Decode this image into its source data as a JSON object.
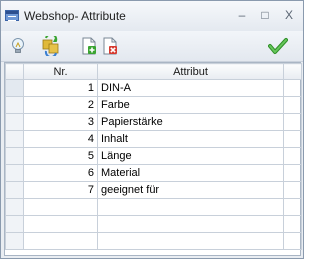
{
  "window": {
    "title": "Webshop- Attribute"
  },
  "title_buttons": {
    "minimize": "–",
    "maximize": "□",
    "close": "X"
  },
  "toolbar": {
    "icons": [
      "lightbulb-icon",
      "refresh-puzzle-icon",
      "add-document-icon",
      "delete-document-icon",
      "confirm-checkmark-icon"
    ]
  },
  "table": {
    "columns": [
      "Nr.",
      "Attribut"
    ],
    "rows": [
      {
        "nr": "1",
        "attribut": "DIN-A"
      },
      {
        "nr": "2",
        "attribut": "Farbe"
      },
      {
        "nr": "3",
        "attribut": "Papierstärke"
      },
      {
        "nr": "4",
        "attribut": "Inhalt"
      },
      {
        "nr": "5",
        "attribut": "Länge"
      },
      {
        "nr": "6",
        "attribut": "Material"
      },
      {
        "nr": "7",
        "attribut": "geeignet für"
      }
    ]
  },
  "colors": {
    "accent": "#3a63a8",
    "ok": "#3aa431",
    "delete": "#d63a2f"
  }
}
